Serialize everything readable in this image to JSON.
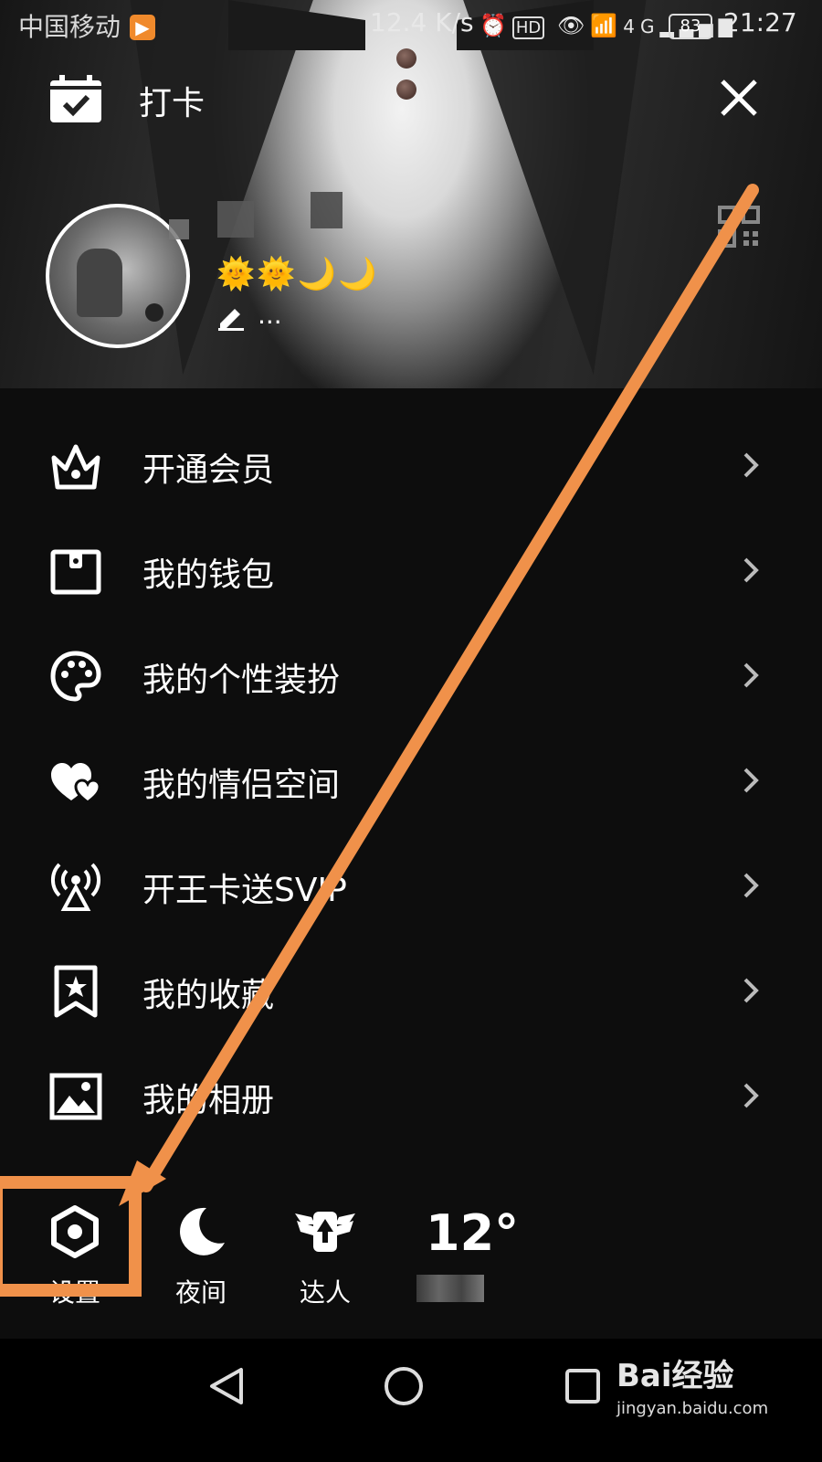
{
  "status_bar": {
    "carrier": "中国移动",
    "network_speed": "12.4 K/s",
    "battery": "83",
    "time": "21:27",
    "icons": [
      "alarm-icon",
      "hd-icon",
      "eye-icon",
      "wifi-icon",
      "4g-signal-icon"
    ]
  },
  "header": {
    "checkin_label": "打卡",
    "level_icons": "🌞🌞🌙🌙",
    "signature": "..."
  },
  "menu": {
    "items": [
      {
        "label": "开通会员",
        "icon": "crown-icon"
      },
      {
        "label": "我的钱包",
        "icon": "wallet-icon"
      },
      {
        "label": "我的个性装扮",
        "icon": "palette-icon"
      },
      {
        "label": "我的情侣空间",
        "icon": "hearts-icon"
      },
      {
        "label": "开王卡送SVIP",
        "icon": "signal-tower-icon"
      },
      {
        "label": "我的收藏",
        "icon": "bookmark-star-icon"
      },
      {
        "label": "我的相册",
        "icon": "image-icon"
      }
    ]
  },
  "toolbar": {
    "settings_label": "设置",
    "night_label": "夜间",
    "expert_label": "达人",
    "weather_temp": "12°"
  },
  "watermark": {
    "brand": "Bai经验",
    "url": "jingyan.baidu.com"
  },
  "colors": {
    "annotation_orange": "#f0914a",
    "background": "#0d0d0d"
  }
}
